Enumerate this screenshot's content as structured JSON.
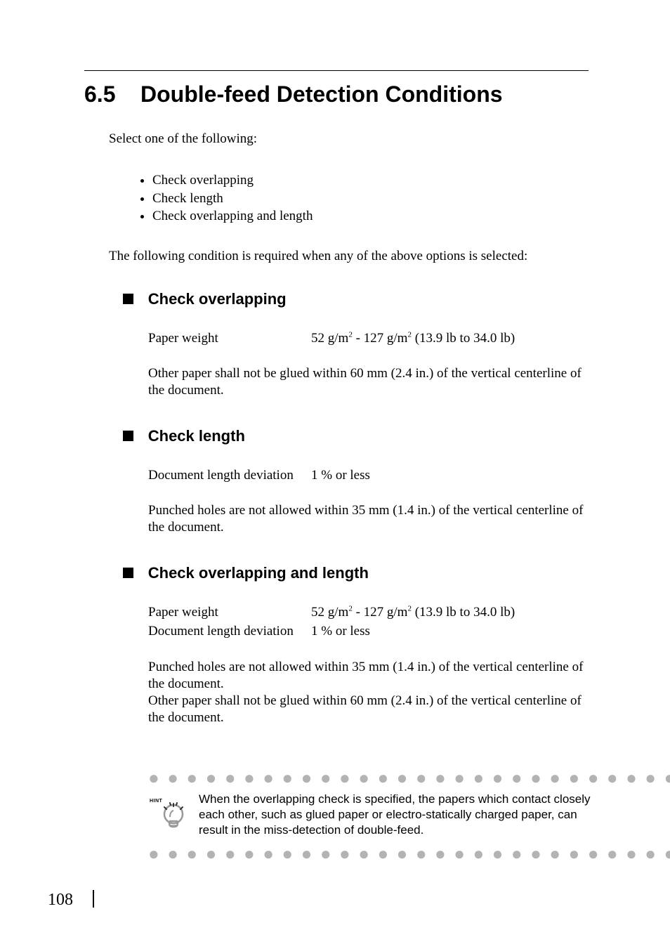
{
  "page_number": "108",
  "section_number": "6.5",
  "section_title": "Double-feed Detection Conditions",
  "intro1": "Select one of the following:",
  "bullets": [
    "Check overlapping",
    "Check length",
    "Check overlapping and length"
  ],
  "intro2": "The following condition is required when any of the above options is selected:",
  "sub1": {
    "title": "Check overlapping",
    "kv": [
      {
        "k": "Paper weight",
        "v_html": "52 g/m<sup>2</sup> - 127 g/m<sup>2</sup> (13.9 lb to 34.0 lb)"
      }
    ],
    "note": "Other paper shall not be glued within 60 mm (2.4 in.) of the vertical centerline of the document."
  },
  "sub2": {
    "title": "Check length",
    "kv": [
      {
        "k": "Document length deviation",
        "v_html": "1 % or less"
      }
    ],
    "note": "Punched holes are not allowed within 35 mm (1.4 in.) of the vertical centerline of the document."
  },
  "sub3": {
    "title": "Check overlapping and length",
    "kv": [
      {
        "k": "Paper weight",
        "v_html": "52 g/m<sup>2</sup> - 127 g/m<sup>2</sup> (13.9 lb to 34.0 lb)"
      },
      {
        "k": "Document length deviation",
        "v_html": "1 % or less"
      }
    ],
    "note1": "Punched holes are not allowed within 35 mm (1.4 in.) of the vertical centerline of the document.",
    "note2": "Other paper shall not be glued within 60 mm (2.4 in.) of the vertical centerline of the document."
  },
  "hint": {
    "label": "HINT",
    "text": "When the overlapping check is specified, the papers which contact closely each other, such as glued paper or electro-statically charged paper, can result in the miss-detection of double-feed."
  },
  "dots": "● ● ● ● ● ● ● ● ● ● ● ● ● ● ● ● ● ● ● ● ● ● ● ● ● ● ● ● ●"
}
